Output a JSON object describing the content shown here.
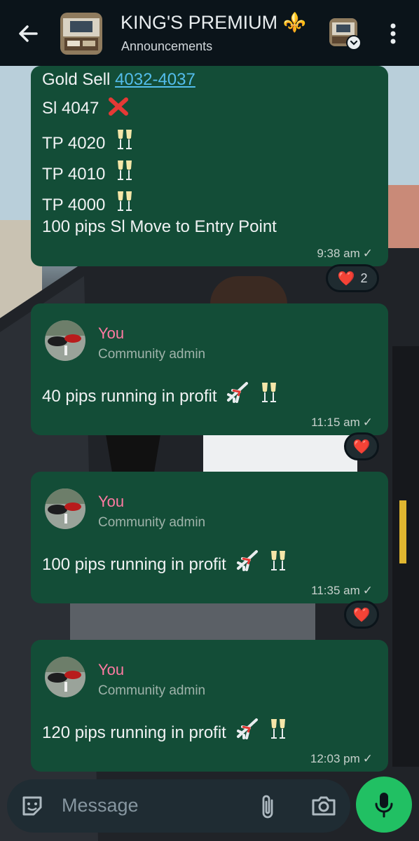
{
  "header": {
    "title": "KING'S PREMIUM ⚜️",
    "subtitle": "Announcements"
  },
  "messages": [
    {
      "lines": [
        "Gold Sell ",
        "4032-4037",
        "Sl 4047",
        "TP 4020",
        "TP 4010",
        "TP 4000",
        "100 pips Sl Move to Entry Point"
      ],
      "time": "9:38 am",
      "reaction": {
        "emoji": "❤️",
        "count": "2"
      }
    },
    {
      "sender": "You",
      "role": "Community admin",
      "text": "40 pips running in profit",
      "time": "11:15 am",
      "reaction": {
        "emoji": "❤️"
      }
    },
    {
      "sender": "You",
      "role": "Community admin",
      "text": "100 pips running in profit",
      "time": "11:35 am",
      "reaction": {
        "emoji": "❤️"
      }
    },
    {
      "sender": "You",
      "role": "Community admin",
      "text": "120 pips running in profit",
      "time": "12:03 pm"
    }
  ],
  "composer": {
    "placeholder": "Message"
  },
  "icons": {
    "back": "arrow-left-icon",
    "menu": "kebab-menu-icon",
    "sticker": "sticker-icon",
    "attach": "paperclip-icon",
    "camera": "camera-icon",
    "mic": "microphone-icon",
    "cross": "red-cross-icon",
    "champagne": "champagne-icon",
    "airplane": "airplane-icon",
    "heart": "heart-icon"
  },
  "colors": {
    "bubble": "#134d37",
    "header": "#0b141a",
    "link": "#53bdeb",
    "sender": "#ff7aa2",
    "mic": "#21c063"
  }
}
